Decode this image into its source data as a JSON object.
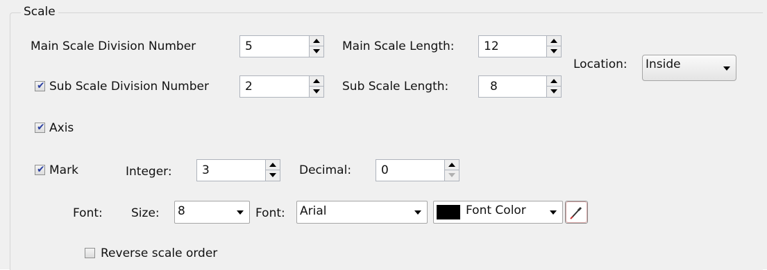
{
  "scale": {
    "group_title": "Scale",
    "main_division": {
      "label": "Main Scale Division Number",
      "value": "5"
    },
    "main_length": {
      "label": "Main Scale Length:",
      "value": "12"
    },
    "sub_division": {
      "label": "Sub Scale Division Number",
      "value": "2",
      "checked": true
    },
    "sub_length": {
      "label": "Sub Scale Length:",
      "value": "8"
    },
    "location": {
      "label": "Location:",
      "value": "Inside"
    },
    "axis": {
      "label": "Axis",
      "checked": true
    },
    "mark": {
      "label": "Mark",
      "checked": true
    },
    "integer": {
      "label": "Integer:",
      "value": "3"
    },
    "decimal": {
      "label": "Decimal:",
      "value": "0"
    },
    "font_row": {
      "font_label": "Font:",
      "size_label": "Size:",
      "size_value": "8",
      "font_label2": "Font:",
      "font_value": "Arial",
      "color_label": "Font Color",
      "color_value": "#000000"
    },
    "reverse": {
      "label": "Reverse scale order",
      "checked": false
    }
  },
  "icons": {
    "checkbox_mark": "✔",
    "color_picker": "eyedropper-icon"
  }
}
